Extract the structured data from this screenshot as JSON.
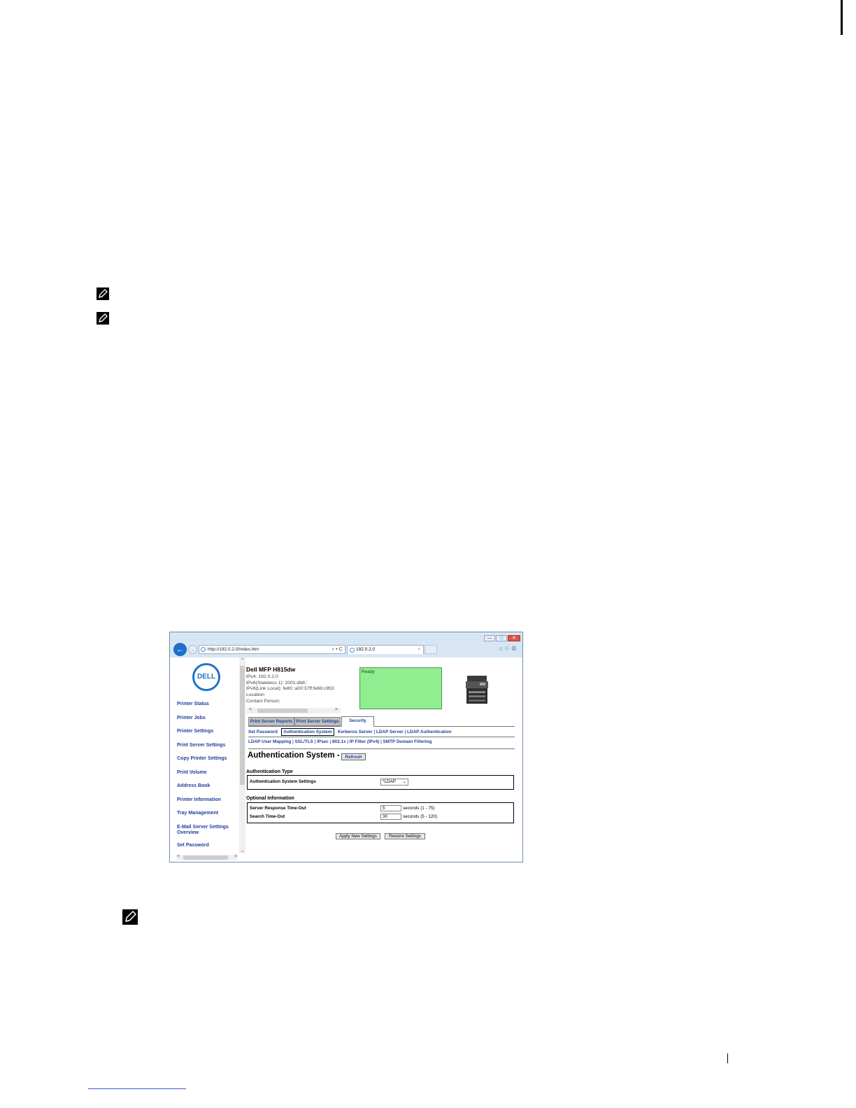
{
  "browser": {
    "url": "http://192.0.2.0/index.htm",
    "tab_label": "192.0.2.0",
    "addr_tools": "⌕ ▾ C",
    "tab_close": "×",
    "window_controls": {
      "minimize": "—",
      "maximize": "□",
      "close": "✕"
    }
  },
  "logo_text": "DELL",
  "nav": {
    "items": [
      "Printer Status",
      "Printer Jobs",
      "Printer Settings",
      "Print Server Settings",
      "Copy Printer Settings",
      "Print Volume",
      "Address Book",
      "Printer Information",
      "Tray Management",
      "E-Mail Server Settings Overview",
      "Set Password"
    ]
  },
  "device": {
    "name": "Dell MFP H815dw",
    "ipv4": "IPv4: 192.0.2.0",
    "ipv6_stateless": "IPv6(Stateless 1): 2001:db8::",
    "ipv6_link_local": "IPv6(Link Local): fe80::a00:37ff:fe68:c953",
    "location": "Location:",
    "contact": "Contact Person:",
    "status": "Ready"
  },
  "tabs": [
    "Print Server Reports",
    "Print Server Settings",
    "Security"
  ],
  "security_links_row1": [
    "Set Password",
    "Authentication System",
    "Kerberos Server",
    "LDAP Server",
    "LDAP Authentication"
  ],
  "security_links_row2": [
    "LDAP User Mapping",
    "SSL/TLS",
    "IPsec",
    "802.1x",
    "IP Filter (IPv4)",
    "SMTP Domain Filtering"
  ],
  "page": {
    "title": "Authentication System -",
    "refresh_label": "Refresh",
    "auth_type_title": "Authentication Type",
    "auth_settings_label": "Authentication System Settings",
    "auth_settings_value": "*LDAP",
    "optional_title": "Optional Information",
    "server_timeout_label": "Server Response Time-Out",
    "server_timeout_value": "5",
    "server_timeout_unit": "seconds (1 - 75)",
    "search_timeout_label": "Search Time-Out",
    "search_timeout_value": "30",
    "search_timeout_unit": "seconds (5 - 120)",
    "apply_label": "Apply New Settings",
    "restore_label": "Restore Settings"
  },
  "colors": {
    "link": "#1f3f9f",
    "status_bg": "#90ee90",
    "dell_blue": "#1d74c7"
  }
}
